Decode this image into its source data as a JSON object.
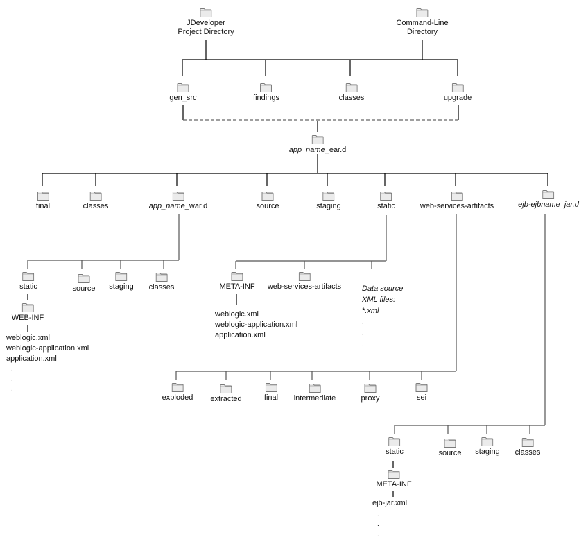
{
  "diagram": {
    "type": "directory-tree",
    "roots": [
      {
        "id": "jdev",
        "label_lines": [
          "JDeveloper",
          "Project Directory"
        ]
      },
      {
        "id": "cmd",
        "label_lines": [
          "Command-Line",
          "Directory"
        ]
      }
    ],
    "level1": [
      {
        "id": "gen_src",
        "label": "gen_src"
      },
      {
        "id": "findings",
        "label": "findings"
      },
      {
        "id": "classes1",
        "label": "classes"
      },
      {
        "id": "upgrade",
        "label": "upgrade"
      }
    ],
    "ear": {
      "italic_part": "app_name",
      "suffix": "_ear.d"
    },
    "ear_children": [
      {
        "id": "final",
        "label": "final"
      },
      {
        "id": "classes2",
        "label": "classes"
      },
      {
        "id": "war",
        "italic_part": "app_name",
        "suffix": "_war.d"
      },
      {
        "id": "source",
        "label": "source"
      },
      {
        "id": "staging",
        "label": "staging"
      },
      {
        "id": "static",
        "label": "static"
      },
      {
        "id": "wsa",
        "label": "web-services-artifacts"
      },
      {
        "id": "ejb",
        "label": "ejb-ejbname_jar.d",
        "italic": true
      }
    ],
    "war_children": [
      {
        "id": "war_static",
        "label": "static"
      },
      {
        "id": "war_source",
        "label": "source"
      },
      {
        "id": "war_staging",
        "label": "staging"
      },
      {
        "id": "war_classes",
        "label": "classes"
      }
    ],
    "war_webinf": {
      "label": "WEB-INF",
      "files": [
        "weblogic.xml",
        "weblogic-application.xml",
        "application.xml"
      ],
      "ellipsis": [
        ".",
        ".",
        "."
      ]
    },
    "static_children": [
      {
        "id": "st_meta",
        "label": "META-INF"
      },
      {
        "id": "st_wsa",
        "label": "web-services-artifacts"
      }
    ],
    "static_meta_files": [
      "weblogic.xml",
      "weblogic-application.xml",
      "application.xml"
    ],
    "datasource_note": {
      "lines": [
        "Data source",
        "XML files:",
        "*.xml"
      ],
      "ellipsis": [
        ".",
        ".",
        "."
      ]
    },
    "wsa_children": [
      {
        "id": "exploded",
        "label": "exploded"
      },
      {
        "id": "extracted",
        "label": "extracted"
      },
      {
        "id": "wsa_final",
        "label": "final"
      },
      {
        "id": "intermediate",
        "label": "intermediate"
      },
      {
        "id": "proxy",
        "label": "proxy"
      },
      {
        "id": "sei",
        "label": "sei"
      }
    ],
    "ejb_children": [
      {
        "id": "ejb_static",
        "label": "static"
      },
      {
        "id": "ejb_source",
        "label": "source"
      },
      {
        "id": "ejb_staging",
        "label": "staging"
      },
      {
        "id": "ejb_classes",
        "label": "classes"
      }
    ],
    "ejb_meta": {
      "label": "META-INF",
      "files": [
        "ejb-jar.xml"
      ],
      "ellipsis": [
        ".",
        ".",
        "."
      ]
    },
    "colors": {
      "line": "#000000",
      "subline": "#555555",
      "folder_fill": "#ebebeb",
      "folder_stroke": "#7a7a7a"
    }
  }
}
